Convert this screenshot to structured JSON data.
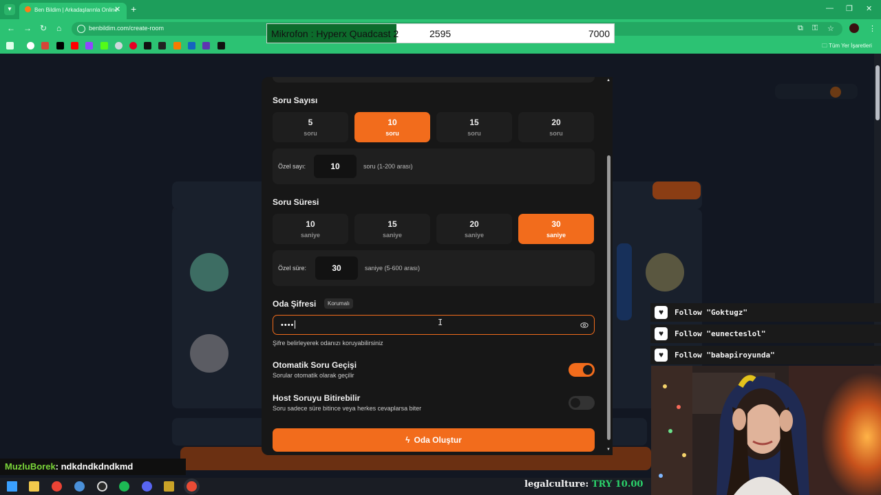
{
  "browser": {
    "tab_title": "Ben Bildim | Arkadaşlarınla Online",
    "url": "benbildim.com/create-room",
    "bookmarks_folder": "Tüm Yer İşaretleri"
  },
  "mic_overlay": {
    "label": "Mikrofon : Hyperx Quadcast 2",
    "current": "2595",
    "goal": "7000"
  },
  "modal": {
    "question_count": {
      "title": "Soru Sayısı",
      "options": [
        {
          "num": "5",
          "unit": "soru",
          "selected": false
        },
        {
          "num": "10",
          "unit": "soru",
          "selected": true
        },
        {
          "num": "15",
          "unit": "soru",
          "selected": false
        },
        {
          "num": "20",
          "unit": "soru",
          "selected": false
        }
      ],
      "custom_label": "Özel sayı:",
      "custom_value": "10",
      "custom_hint": "soru (1-200 arası)"
    },
    "question_time": {
      "title": "Soru Süresi",
      "options": [
        {
          "num": "10",
          "unit": "saniye",
          "selected": false
        },
        {
          "num": "15",
          "unit": "saniye",
          "selected": false
        },
        {
          "num": "20",
          "unit": "saniye",
          "selected": false
        },
        {
          "num": "30",
          "unit": "saniye",
          "selected": true
        }
      ],
      "custom_label": "Özel süre:",
      "custom_value": "30",
      "custom_hint": "saniye (5-600 arası)"
    },
    "password": {
      "title": "Oda Şifresi",
      "badge": "Korumalı",
      "value": "••••",
      "help": "Şifre belirleyerek odanızı koruyabilirsiniz"
    },
    "auto_next": {
      "title": "Otomatik Soru Geçişi",
      "desc": "Sorular otomatik olarak geçilir",
      "on": true
    },
    "host_end": {
      "title": "Host Soruyu Bitirebilir",
      "desc": "Soru sadece süre bitince veya herkes cevaplarsa biter",
      "on": false
    },
    "create_button": "Oda Oluştur"
  },
  "follows": [
    "Follow \"Goktugz\"",
    "Follow \"eunecteslol\"",
    "Follow \"babapiroyunda\""
  ],
  "chat": {
    "user": "MuzluBorek",
    "message": ": ndkdndkdndkmd"
  },
  "donation": {
    "user": "legalculture:",
    "amount": "TRY 10.00"
  },
  "colors": {
    "accent": "#f26c1c",
    "browser_green": "#2cc273",
    "chat_user": "#7bd63a"
  }
}
